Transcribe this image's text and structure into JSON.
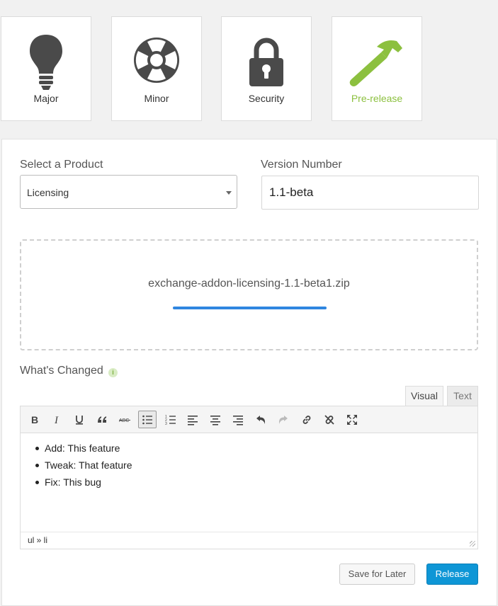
{
  "release_types": [
    {
      "label": "Major",
      "icon": "lightbulb-icon"
    },
    {
      "label": "Minor",
      "icon": "aperture-icon"
    },
    {
      "label": "Security",
      "icon": "lock-icon"
    },
    {
      "label": "Pre-release",
      "icon": "hammer-icon"
    }
  ],
  "form": {
    "product_label": "Select a Product",
    "product_value": "Licensing",
    "version_label": "Version Number",
    "version_value": "1.1-beta"
  },
  "upload": {
    "filename": "exchange-addon-licensing-1.1-beta1.zip",
    "progress": 1.0
  },
  "changes": {
    "label": "What's Changed",
    "info_glyph": "i",
    "tabs": {
      "visual": "Visual",
      "text": "Text"
    },
    "items": [
      "Add: This feature",
      "Tweak: That feature",
      "Fix: This bug"
    ],
    "path": "ul » li"
  },
  "actions": {
    "save_label": "Save for Later",
    "release_label": "Release"
  },
  "colors": {
    "accent_green": "#8cc03f",
    "primary_blue": "#0e96d6",
    "progress_blue": "#2f86e0",
    "icon_gray": "#4a4a4a"
  }
}
